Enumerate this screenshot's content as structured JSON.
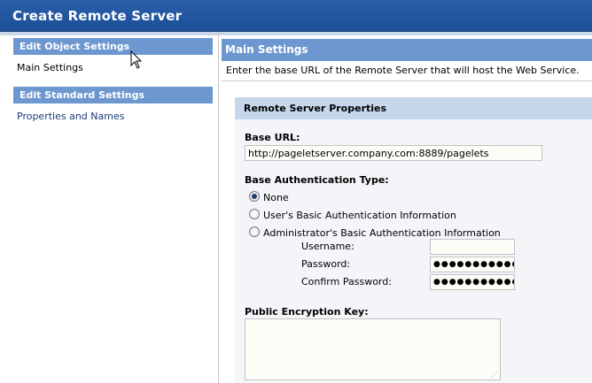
{
  "window": {
    "title": "Create Remote Server"
  },
  "sidebar": {
    "sections": [
      {
        "header": "Edit Object Settings",
        "items": [
          {
            "label": "Main Settings"
          }
        ]
      },
      {
        "header": "Edit Standard Settings",
        "items": [
          {
            "label": "Properties and Names"
          }
        ]
      }
    ]
  },
  "main": {
    "header": "Main Settings",
    "intro": "Enter the base URL of the Remote Server that will host the Web Service.",
    "panel": {
      "title": "Remote Server Properties",
      "base_url": {
        "label": "Base URL:",
        "value": "http://pageletserver.company.com:8889/pagelets"
      },
      "auth": {
        "label": "Base Authentication Type:",
        "options": [
          {
            "label": "None",
            "selected": true
          },
          {
            "label": "User's Basic Authentication Information",
            "selected": false
          },
          {
            "label": "Administrator's Basic Authentication Information",
            "selected": false
          }
        ],
        "username_label": "Username:",
        "username_value": "",
        "password_label": "Password:",
        "password_value": "●●●●●●●●●●●●",
        "confirm_label": "Confirm Password:",
        "confirm_value": "●●●●●●●●●●●●"
      },
      "encryption_key": {
        "label": "Public Encryption Key:",
        "value": ""
      }
    }
  }
}
